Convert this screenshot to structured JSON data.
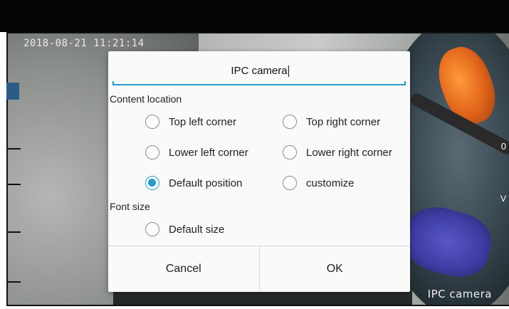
{
  "osd": {
    "timestamp": "2018-08-21 11:21:14",
    "camera_name": "IPC camera"
  },
  "side": {
    "right_0": "0",
    "right_v": "V"
  },
  "dialog": {
    "title_value": "IPC camera",
    "content_location_label": "Content location",
    "location_options": [
      {
        "label": "Top left corner",
        "checked": false
      },
      {
        "label": "Top right corner",
        "checked": false
      },
      {
        "label": "Lower left corner",
        "checked": false
      },
      {
        "label": "Lower right corner",
        "checked": false
      },
      {
        "label": "Default position",
        "checked": true
      },
      {
        "label": "customize",
        "checked": false
      }
    ],
    "font_size_label": "Font size",
    "font_size_options": [
      {
        "label": "Default size",
        "checked": false
      }
    ],
    "cancel_label": "Cancel",
    "ok_label": "OK"
  },
  "colors": {
    "accent": "#2a9ac9"
  }
}
